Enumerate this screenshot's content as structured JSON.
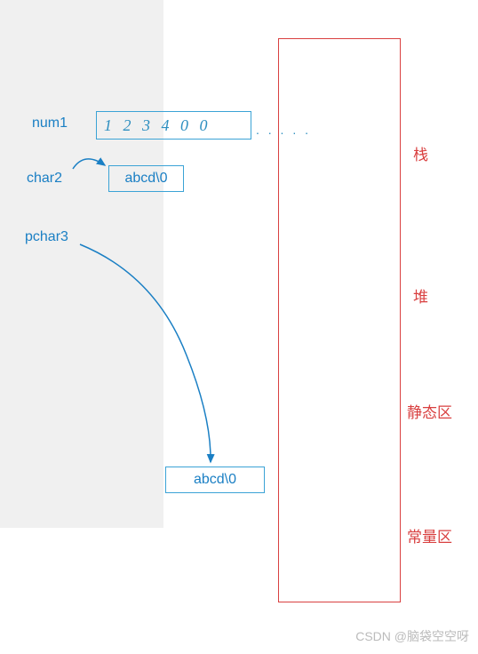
{
  "variables": {
    "num1": {
      "label": "num1",
      "content": "1 2 3 4 0 0"
    },
    "dots": ". . .  . .",
    "char2": {
      "label": "char2",
      "content": "abcd\\0"
    },
    "pchar3": {
      "label": "pchar3",
      "content": "abcd\\0"
    }
  },
  "memory_regions": {
    "stack": "栈",
    "heap": "堆",
    "static": "静态区",
    "const": "常量区"
  },
  "watermark": "CSDN @脑袋空空呀"
}
